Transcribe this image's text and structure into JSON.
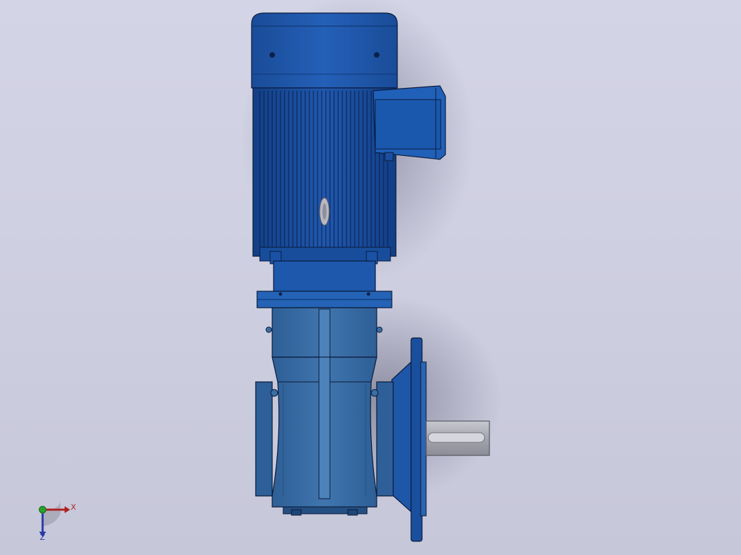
{
  "viewport": {
    "background_top": "#d3d4e6",
    "background_bottom": "#c6c7d9"
  },
  "model": {
    "name": "vertical-gear-motor",
    "colors": {
      "motor_blue": "#1e56a8",
      "motor_dark": "#103a7a",
      "gearbox_blue": "#3a6ea5",
      "gearbox_dark": "#244f82",
      "shaft_grey": "#a9aab3",
      "edge": "#0a1a3a"
    }
  },
  "triad": {
    "x_label": "X",
    "z_label": "Z",
    "x_color": "#b02020",
    "y_color": "#2aa02a",
    "z_color": "#2a3aa8",
    "x_icon": "axis-x-arrow",
    "z_icon": "axis-z-arrow",
    "y_icon": "axis-y-dot"
  }
}
